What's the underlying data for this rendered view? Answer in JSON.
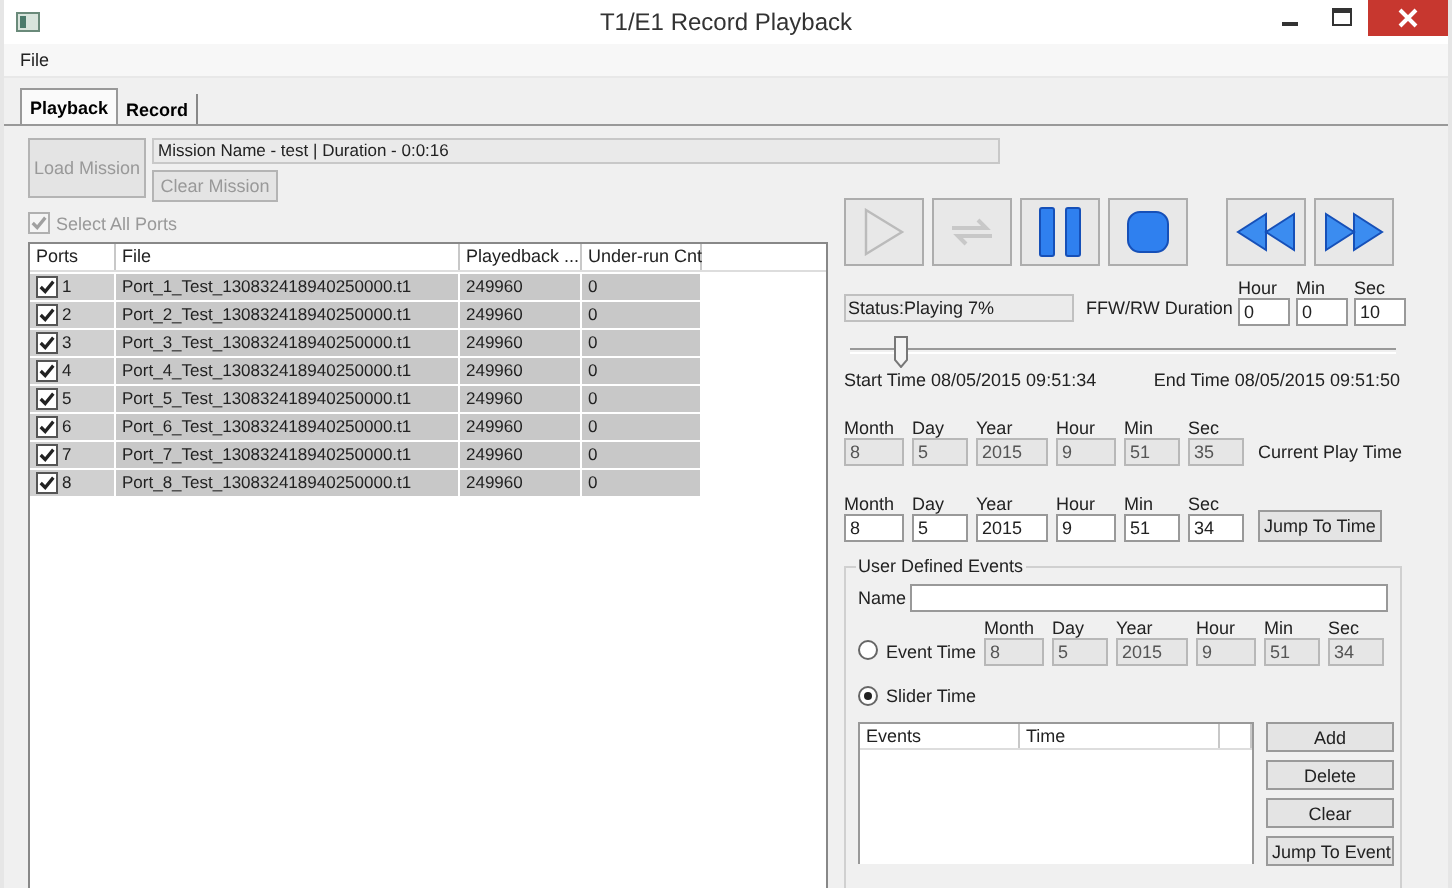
{
  "window": {
    "title": "T1/E1 Record Playback"
  },
  "menu": [
    "File"
  ],
  "tabs": [
    {
      "label": "Playback",
      "selected": true
    },
    {
      "label": "Record",
      "selected": false
    }
  ],
  "mission": {
    "load_button": {
      "label": "Load Mission",
      "disabled": true
    },
    "info": "Mission Name - test | Duration - 0:0:16",
    "clear_button": {
      "label": "Clear Mission",
      "disabled": true
    },
    "select_all": {
      "label": "Select All Ports",
      "checked": true,
      "disabled": true
    }
  },
  "ports_table": {
    "columns": [
      "Ports",
      "File",
      "Playedback ...",
      "Under-run Cnt"
    ],
    "rows": [
      {
        "checked": true,
        "port": "1",
        "file": "Port_1_Test_130832418940250000.t1",
        "playedback": "249960",
        "underrun": "0"
      },
      {
        "checked": true,
        "port": "2",
        "file": "Port_2_Test_130832418940250000.t1",
        "playedback": "249960",
        "underrun": "0"
      },
      {
        "checked": true,
        "port": "3",
        "file": "Port_3_Test_130832418940250000.t1",
        "playedback": "249960",
        "underrun": "0"
      },
      {
        "checked": true,
        "port": "4",
        "file": "Port_4_Test_130832418940250000.t1",
        "playedback": "249960",
        "underrun": "0"
      },
      {
        "checked": true,
        "port": "5",
        "file": "Port_5_Test_130832418940250000.t1",
        "playedback": "249960",
        "underrun": "0"
      },
      {
        "checked": true,
        "port": "6",
        "file": "Port_6_Test_130832418940250000.t1",
        "playedback": "249960",
        "underrun": "0"
      },
      {
        "checked": true,
        "port": "7",
        "file": "Port_7_Test_130832418940250000.t1",
        "playedback": "249960",
        "underrun": "0"
      },
      {
        "checked": true,
        "port": "8",
        "file": "Port_8_Test_130832418940250000.t1",
        "playedback": "249960",
        "underrun": "0"
      }
    ]
  },
  "transport": [
    {
      "kind": "play",
      "disabled": true
    },
    {
      "kind": "loop",
      "disabled": true
    },
    {
      "kind": "pause",
      "disabled": false
    },
    {
      "kind": "stop",
      "disabled": false
    },
    {
      "kind": "rewind",
      "disabled": false
    },
    {
      "kind": "forward",
      "disabled": false
    }
  ],
  "status": "Status:Playing 7%",
  "ffw": {
    "label": "FFW/RW Duration",
    "fields": [
      {
        "label": "Hour",
        "value": "0",
        "disabled": false
      },
      {
        "label": "Min",
        "value": "0",
        "disabled": false
      },
      {
        "label": "Sec",
        "value": "10",
        "disabled": false
      }
    ]
  },
  "slider": {
    "level": 0.09
  },
  "start_time": "Start Time 08/05/2015 09:51:34",
  "end_time": "End Time 08/05/2015 09:51:50",
  "current_time": {
    "label": "Current Play Time",
    "fields": [
      {
        "label": "Month",
        "value": "8",
        "disabled": true
      },
      {
        "label": "Day",
        "value": "5",
        "disabled": true
      },
      {
        "label": "Year",
        "value": "2015",
        "disabled": true
      },
      {
        "label": "Hour",
        "value": "9",
        "disabled": true
      },
      {
        "label": "Min",
        "value": "51",
        "disabled": true
      },
      {
        "label": "Sec",
        "value": "35",
        "disabled": true
      }
    ]
  },
  "jump": {
    "button": "Jump To Time",
    "fields": [
      {
        "label": "Month",
        "value": "8",
        "disabled": false
      },
      {
        "label": "Day",
        "value": "5",
        "disabled": false
      },
      {
        "label": "Year",
        "value": "2015",
        "disabled": false
      },
      {
        "label": "Hour",
        "value": "9",
        "disabled": false
      },
      {
        "label": "Min",
        "value": "51",
        "disabled": false
      },
      {
        "label": "Sec",
        "value": "34",
        "disabled": false
      }
    ]
  },
  "events": {
    "title": "User Defined Events",
    "name_label": "Name",
    "event_time": {
      "label": "Event Time",
      "selected": false,
      "fields": [
        {
          "label": "Month",
          "value": "8",
          "disabled": true
        },
        {
          "label": "Day",
          "value": "5",
          "disabled": true
        },
        {
          "label": "Year",
          "value": "2015",
          "disabled": true
        },
        {
          "label": "Hour",
          "value": "9",
          "disabled": true
        },
        {
          "label": "Min",
          "value": "51",
          "disabled": true
        },
        {
          "label": "Sec",
          "value": "34",
          "disabled": true
        }
      ]
    },
    "slider_time": {
      "label": "Slider Time",
      "selected": true
    },
    "columns": [
      "Events",
      "Time"
    ],
    "buttons": [
      "Add",
      "Delete",
      "Clear",
      "Jump To Event"
    ]
  }
}
